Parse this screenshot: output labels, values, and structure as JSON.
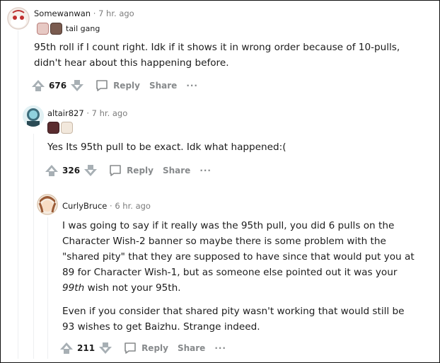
{
  "comments": [
    {
      "username": "Somewanwan",
      "separator": "·",
      "time": "7 hr. ago",
      "flair_icons": [
        "character-flair-icon-1",
        "character-flair-icon-2"
      ],
      "flair_text": "tail gang",
      "body": [
        "95th roll if I count right. Idk if it shows it in wrong order because of 10-pulls, didn't hear about this happening before."
      ],
      "score": "676",
      "reply_label": "Reply",
      "share_label": "Share",
      "more_label": "···"
    },
    {
      "username": "altair827",
      "separator": "·",
      "time": "7 hr. ago",
      "flair_icons": [
        "character-flair-icon-1",
        "character-flair-icon-2"
      ],
      "body": [
        "Yes Its 95th pull to be exact. Idk what happened:("
      ],
      "score": "326",
      "reply_label": "Reply",
      "share_label": "Share",
      "more_label": "···"
    },
    {
      "username": "CurlyBruce",
      "separator": "·",
      "time": "6 hr. ago",
      "body_p1_before": "I was going to say if it really was the 95th pull, you did 6 pulls on the Character Wish-2 banner so maybe there is some problem with the \"shared pity\" that they are supposed to have since that would put you at 89 for Character Wish-1, but as someone else pointed out it was your ",
      "body_p1_em": "99th",
      "body_p1_after": " wish not your 95th.",
      "body_p2": "Even if you consider that shared pity wasn't working that would still be 93 wishes to get Baizhu. Strange indeed.",
      "score": "211",
      "reply_label": "Reply",
      "share_label": "Share",
      "more_label": "···"
    }
  ],
  "colors": {
    "meta_gray": "#7c7c7c",
    "action_gray": "#878a8c",
    "thread_line": "#edeff1"
  }
}
